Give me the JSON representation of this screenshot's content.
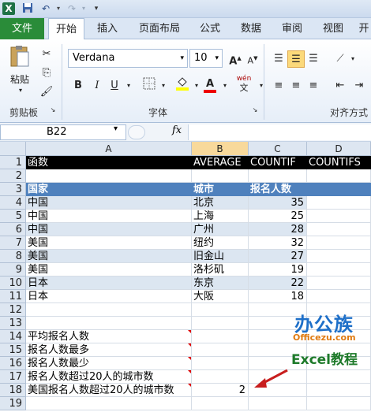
{
  "qat": {
    "excel_icon": "X",
    "save_icon": "save-icon",
    "undo_icon": "undo-icon",
    "redo_icon": "redo-icon",
    "customize_icon": "customize-icon"
  },
  "tabs": [
    {
      "label": "文件"
    },
    {
      "label": "开始"
    },
    {
      "label": "插入"
    },
    {
      "label": "页面布局"
    },
    {
      "label": "公式"
    },
    {
      "label": "数据"
    },
    {
      "label": "审阅"
    },
    {
      "label": "视图"
    },
    {
      "label": "开"
    }
  ],
  "ribbon": {
    "paste_label": "粘贴",
    "clipboard_label": "剪贴板",
    "font_name": "Verdana",
    "font_size": "10",
    "font_label": "字体",
    "align_label": "对齐方式",
    "bold": "B",
    "italic": "I",
    "underline": "U",
    "wen": "wén"
  },
  "formula_bar": {
    "name_box": "B22",
    "fx": "fx"
  },
  "columns": [
    "A",
    "B",
    "C",
    "D"
  ],
  "rows": [
    {
      "n": "1",
      "a": "函数",
      "b": "AVERAGE",
      "c": "COUNTIF",
      "d": "COUNTIFS"
    },
    {
      "n": "2",
      "a": "",
      "b": "",
      "c": "",
      "d": ""
    },
    {
      "n": "3",
      "a": "国家",
      "b": "城市",
      "c": "报名人数",
      "d": ""
    },
    {
      "n": "4",
      "a": "中国",
      "b": "北京",
      "c": "35",
      "d": ""
    },
    {
      "n": "5",
      "a": "中国",
      "b": "上海",
      "c": "25",
      "d": ""
    },
    {
      "n": "6",
      "a": "中国",
      "b": "广州",
      "c": "28",
      "d": ""
    },
    {
      "n": "7",
      "a": "美国",
      "b": "纽约",
      "c": "32",
      "d": ""
    },
    {
      "n": "8",
      "a": "美国",
      "b": "旧金山",
      "c": "27",
      "d": ""
    },
    {
      "n": "9",
      "a": "美国",
      "b": "洛杉矶",
      "c": "19",
      "d": ""
    },
    {
      "n": "10",
      "a": "日本",
      "b": "东京",
      "c": "22",
      "d": ""
    },
    {
      "n": "11",
      "a": "日本",
      "b": "大阪",
      "c": "18",
      "d": ""
    },
    {
      "n": "12",
      "a": "",
      "b": "",
      "c": "",
      "d": ""
    },
    {
      "n": "13",
      "a": "",
      "b": "",
      "c": "",
      "d": ""
    },
    {
      "n": "14",
      "a": "平均报名人数",
      "b": "",
      "c": "",
      "d": ""
    },
    {
      "n": "15",
      "a": "报名人数最多",
      "b": "",
      "c": "",
      "d": ""
    },
    {
      "n": "16",
      "a": "报名人数最少",
      "b": "",
      "c": "",
      "d": ""
    },
    {
      "n": "17",
      "a": "报名人数超过20人的城市数",
      "b": "",
      "c": "",
      "d": ""
    },
    {
      "n": "18",
      "a": "美国报名人数超过20人的城市数",
      "b": "2",
      "c": "",
      "d": ""
    },
    {
      "n": "19",
      "a": "",
      "b": "",
      "c": "",
      "d": ""
    }
  ],
  "watermark": {
    "line1": "办公族",
    "line2": "Officezu.com",
    "line3": "Excel教程"
  },
  "colors": {
    "header_black": "#000000",
    "header_blue": "#4f81bd",
    "band": "#dce6f1",
    "file_tab": "#2a8c39"
  }
}
